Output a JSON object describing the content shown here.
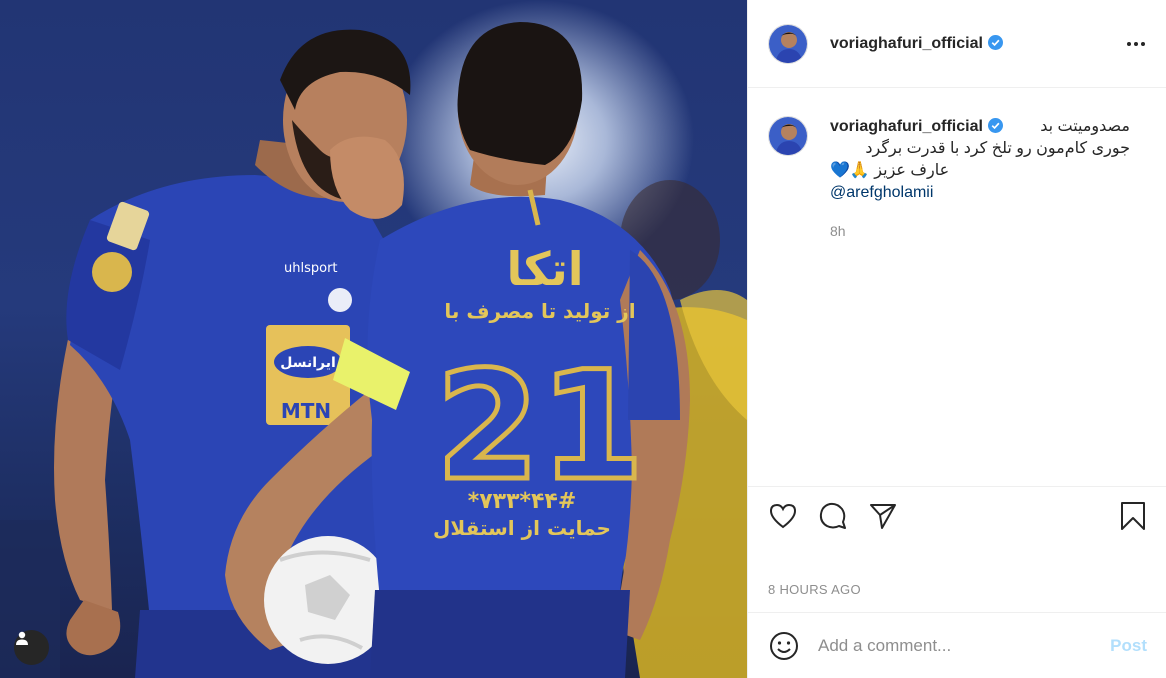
{
  "post": {
    "image_alt": "Two football players in blue jerseys",
    "jersey_text": {
      "brand": "uhlsport",
      "sponsor_top": "اتکا",
      "sponsor_line": "از تولید تا مصرف با",
      "number": "21",
      "phone": "*۷۳۳*۴۴#",
      "support": "حمایت از استقلال",
      "sponsor_chest": "ایرانسل",
      "mtn": "MTN"
    }
  },
  "header": {
    "username": "voriaghafuri_official"
  },
  "caption": {
    "username": "voriaghafuri_official",
    "line1": "مصدومیتت بد",
    "line2": "جوری کام‌مون رو تلخ کرد با قدرت برگرد",
    "line3": "عارف عزیز 🙏💙",
    "mention": "@arefgholamii",
    "time": "8h"
  },
  "timestamp": "8 HOURS AGO",
  "comment_box": {
    "placeholder": "Add a comment...",
    "post_label": "Post"
  },
  "colors": {
    "jersey_blue": "#2a3fa8",
    "verified": "#3897f0",
    "post_disabled": "#b2dffc",
    "mention": "#00376b"
  }
}
